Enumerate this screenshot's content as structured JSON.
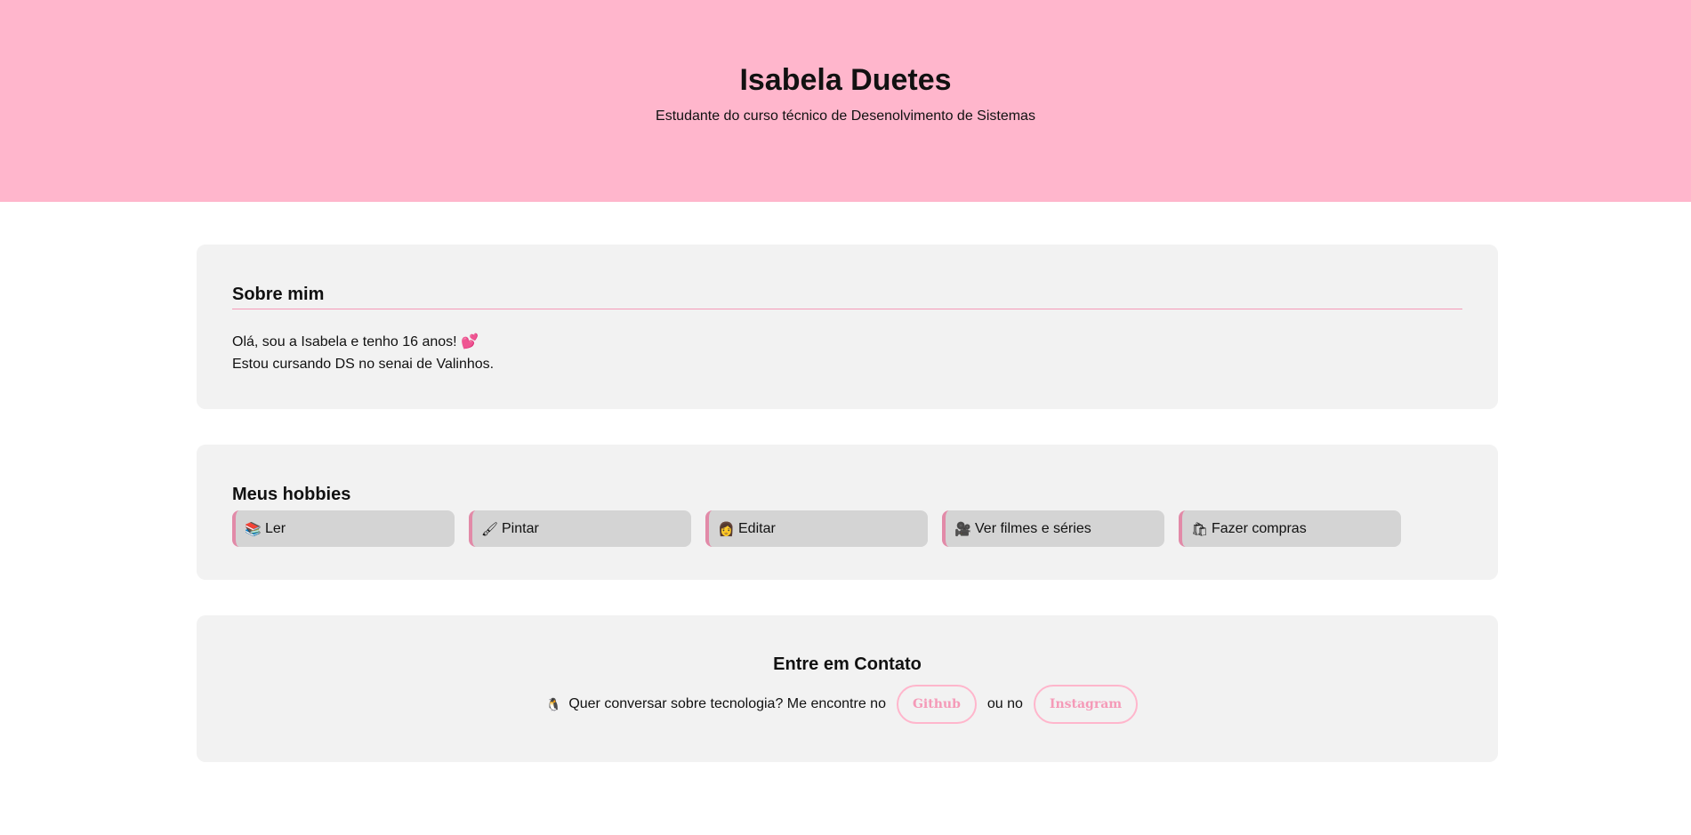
{
  "header": {
    "name": "Isabela Duetes",
    "subtitle": "Estudante do curso técnico de Desenolvimento de Sistemas"
  },
  "about": {
    "title": "Sobre mim",
    "line1": "Olá, sou a Isabela e tenho 16 anos!",
    "line1_emoji": "💕",
    "line2": "Estou cursando DS no senai de Valinhos."
  },
  "hobbies": {
    "title": "Meus hobbies",
    "items": [
      {
        "icon": "📚",
        "icon_name": "books-icon",
        "label": "Ler"
      },
      {
        "icon": "🖌",
        "icon_name": "paintbrush-icon",
        "label": "Pintar"
      },
      {
        "icon": "👩",
        "icon_name": "editor-icon",
        "label": "Editar"
      },
      {
        "icon": "🎥",
        "icon_name": "movie-camera-icon",
        "label": "Ver filmes e séries"
      },
      {
        "icon": "🛍",
        "icon_name": "shopping-bags-icon",
        "label": "Fazer compras"
      }
    ]
  },
  "contact": {
    "title": "Entre em Contato",
    "icon": "🐧",
    "text": "Quer conversar sobre tecnologia? Me encontre no",
    "github_label": "Github",
    "or_text": "ou no",
    "instagram_label": "Instagram"
  },
  "colors": {
    "header_bg": "#ffb6cc",
    "card_bg": "#f2f2f2",
    "accent": "#f59ab8",
    "hobby_bg": "#d4d4d4"
  }
}
